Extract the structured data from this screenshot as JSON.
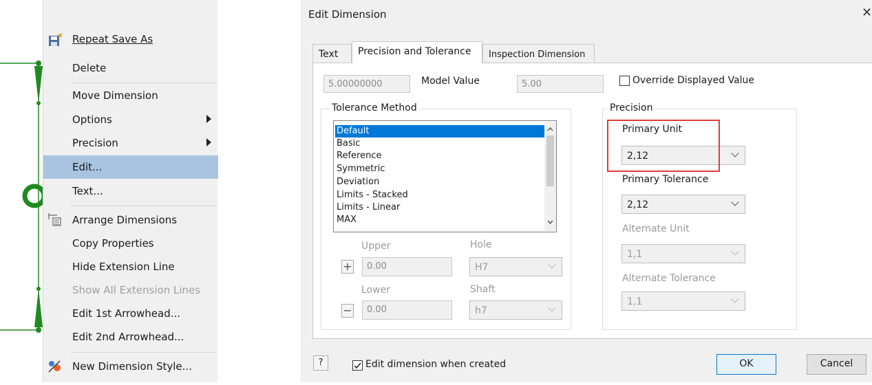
{
  "context_menu": {
    "items": [
      {
        "label": "Repeat Save As",
        "icon": "save-as-icon"
      },
      {
        "label": "Delete"
      },
      {
        "label": "Move Dimension"
      },
      {
        "label": "Options",
        "submenu": true
      },
      {
        "label": "Precision",
        "submenu": true
      },
      {
        "label": "Edit...",
        "selected": true
      },
      {
        "label": "Text..."
      },
      {
        "label": "Arrange Dimensions",
        "icon": "arrange-dimensions-icon"
      },
      {
        "label": "Copy Properties"
      },
      {
        "label": "Hide Extension Line"
      },
      {
        "label": "Show All Extension Lines",
        "disabled": true
      },
      {
        "label": "Edit 1st Arrowhead..."
      },
      {
        "label": "Edit 2nd Arrowhead..."
      },
      {
        "label": "New Dimension Style...",
        "icon": "dimension-style-icon"
      }
    ]
  },
  "dialog": {
    "title": "Edit Dimension",
    "tabs": [
      "Text",
      "Precision and Tolerance",
      "Inspection Dimension"
    ],
    "active_tab": "Precision and Tolerance",
    "model_value_field": "5.00000000",
    "model_value_label": "Model Value",
    "displayed_value_field": "5.00",
    "override_label": "Override Displayed Value",
    "tolerance_method": {
      "title": "Tolerance Method",
      "options": [
        "Default",
        "Basic",
        "Reference",
        "Symmetric",
        "Deviation",
        "Limits - Stacked",
        "Limits - Linear",
        "MAX"
      ],
      "selected": "Default"
    },
    "upper_label": "Upper",
    "upper_value": "0.00",
    "lower_label": "Lower",
    "lower_value": "0.00",
    "hole_label": "Hole",
    "hole_value": "H7",
    "shaft_label": "Shaft",
    "shaft_value": "h7",
    "plus_symbol": "+",
    "minus_symbol": "−",
    "precision": {
      "title": "Precision",
      "primary_unit_label": "Primary Unit",
      "primary_unit_value": "2,12",
      "primary_tolerance_label": "Primary Tolerance",
      "primary_tolerance_value": "2,12",
      "alternate_unit_label": "Alternate Unit",
      "alternate_unit_value": "1,1",
      "alternate_tolerance_label": "Alternate Tolerance",
      "alternate_tolerance_value": "1,1"
    },
    "help_symbol": "?",
    "edit_when_created_label": "Edit dimension when created",
    "ok_label": "OK",
    "cancel_label": "Cancel",
    "close_symbol": "✕"
  },
  "colors": {
    "accent": "#0078d7",
    "highlight_box": "#e23b3b",
    "dimension_green": "#1f8a1f"
  }
}
